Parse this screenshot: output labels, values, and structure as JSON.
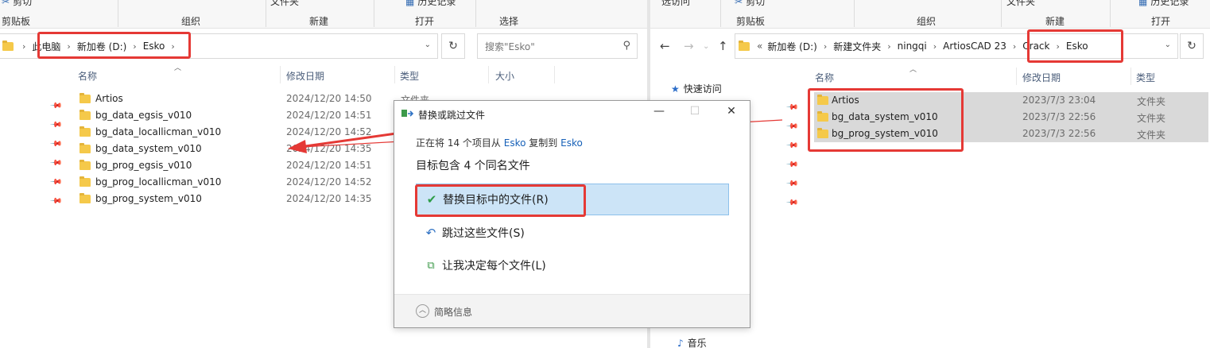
{
  "left_window": {
    "ribbon": {
      "commands": [
        "剪切",
        "文件夹",
        "历史记录"
      ],
      "groups": [
        "剪贴板",
        "组织",
        "新建",
        "打开",
        "选择"
      ]
    },
    "breadcrumb": [
      "此电脑",
      "新加卷 (D:)",
      "Esko"
    ],
    "search_placeholder": "搜索\"Esko\"",
    "columns": {
      "name": "名称",
      "date": "修改日期",
      "type": "类型",
      "size": "大小"
    },
    "files": [
      {
        "name": "Artios",
        "date": "2024/12/20 14:50",
        "type": "文件夹"
      },
      {
        "name": "bg_data_egsis_v010",
        "date": "2024/12/20 14:51",
        "type": ""
      },
      {
        "name": "bg_data_locallicman_v010",
        "date": "2024/12/20 14:52",
        "type": ""
      },
      {
        "name": "bg_data_system_v010",
        "date": "2024/12/20 14:35",
        "type": ""
      },
      {
        "name": "bg_prog_egsis_v010",
        "date": "2024/12/20 14:51",
        "type": ""
      },
      {
        "name": "bg_prog_locallicman_v010",
        "date": "2024/12/20 14:52",
        "type": ""
      },
      {
        "name": "bg_prog_system_v010",
        "date": "2024/12/20 14:35",
        "type": ""
      }
    ]
  },
  "right_window": {
    "ribbon": {
      "commands": [
        "选访问",
        "剪切",
        "文件夹",
        "历史记录"
      ],
      "groups": [
        "剪贴板",
        "组织",
        "新建",
        "打开"
      ]
    },
    "breadcrumb": [
      "新加卷 (D:)",
      "新建文件夹",
      "ningqi",
      "ArtiosCAD 23",
      "Crack",
      "Esko"
    ],
    "breadcrumb_overflow": "«",
    "columns": {
      "name": "名称",
      "date": "修改日期",
      "type": "类型"
    },
    "sidebar": {
      "quick_access": "快速访问",
      "music": "音乐"
    },
    "files": [
      {
        "name": "Artios",
        "date": "2023/7/3 23:04",
        "type": "文件夹"
      },
      {
        "name": "bg_data_system_v010",
        "date": "2023/7/3 22:56",
        "type": "文件夹"
      },
      {
        "name": "bg_prog_system_v010",
        "date": "2023/7/3 22:56",
        "type": "文件夹"
      }
    ]
  },
  "dialog": {
    "title": "替换或跳过文件",
    "copying_prefix": "正在将 14 个项目从",
    "source": "Esko",
    "copying_mid": "复制到",
    "dest": "Esko",
    "heading": "目标包含 4 个同名文件",
    "options": {
      "replace": "替换目标中的文件(R)",
      "skip": "跳过这些文件(S)",
      "decide": "让我决定每个文件(L)"
    },
    "footer": "简略信息"
  },
  "colors": {
    "highlight": "#e53935",
    "selected_option": "#cce4f7",
    "folder": "#f5c94a",
    "link": "#1660b8"
  }
}
